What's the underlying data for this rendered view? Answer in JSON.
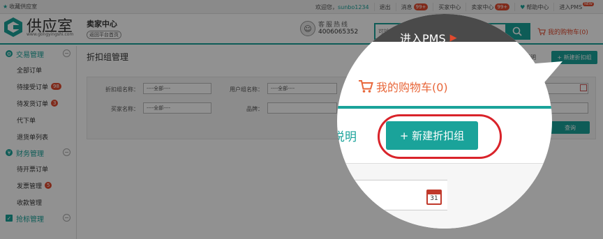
{
  "topbar": {
    "favorite": "收藏供应室",
    "welcome": "欢迎您，",
    "username": "sunbo1234",
    "logout": "退出",
    "messages": "消息",
    "messages_count": "99+",
    "buyer_center": "买家中心",
    "seller_center": "卖家中心",
    "seller_count": "99+",
    "help_center": "帮助中心",
    "pms": "进入PMS",
    "new_tag": "NEW"
  },
  "header": {
    "logo_text": "供应室",
    "logo_domain": "www.gongyingshi.com",
    "seller_title": "卖家中心",
    "back_platform": "返回平台首页",
    "hotline_label": "客服热线",
    "hotline_number": "4006065352",
    "search_placeholder": "可输入产品名称、规格、生产厂家名称进行搜索",
    "cart": "我的购物车(0)"
  },
  "sidebar": {
    "groups": [
      {
        "title": "交易管理",
        "items": [
          {
            "label": "全部订单",
            "badge": ""
          },
          {
            "label": "待接受订单",
            "badge": "98"
          },
          {
            "label": "待发货订单",
            "badge": "3"
          },
          {
            "label": "代下单",
            "badge": ""
          },
          {
            "label": "退货单列表",
            "badge": ""
          }
        ]
      },
      {
        "title": "财务管理",
        "items": [
          {
            "label": "待开票订单",
            "badge": ""
          },
          {
            "label": "发票管理",
            "badge": "5"
          },
          {
            "label": "收款管理",
            "badge": ""
          }
        ]
      },
      {
        "title": "抢标管理",
        "items": []
      }
    ]
  },
  "main": {
    "page_title": "折扣组管理",
    "help": "帮助说明",
    "new_button": "+ 新建折扣组",
    "filter": {
      "group_name_label": "折扣组名称：",
      "group_name_value": "----全部----",
      "user_group_label": "用户组名称：",
      "user_group_value": "----全部----",
      "buyer_label": "买家名称：",
      "buyer_value": "----全部----",
      "brand_label": "品牌：",
      "query_button": "查询"
    }
  },
  "magnifier": {
    "pms": "进入PMS",
    "cart": "我的购物车(0)",
    "help_fragment": "说明",
    "button": "+ 新建折扣组",
    "calendar_day": "31"
  },
  "colors": {
    "accent": "#1aa39a",
    "badge": "#e24a2e",
    "highlight_ring": "#d9232a"
  }
}
